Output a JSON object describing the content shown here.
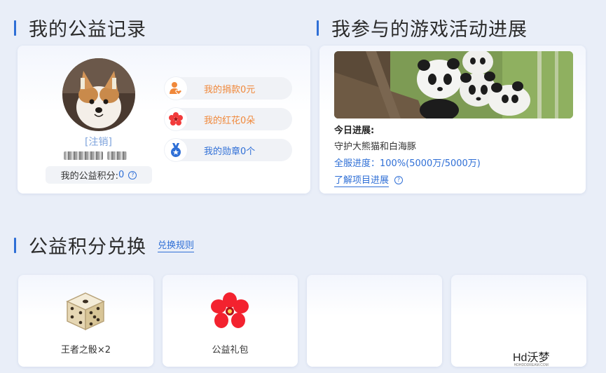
{
  "titles": {
    "records": "我的公益记录",
    "game_progress": "我参与的游戏活动进展",
    "exchange": "公益积分兑换"
  },
  "exchange_rules_link": "兑换规则",
  "profile": {
    "logout_label": "[注销]",
    "points_label": "我的公益积分:",
    "points_value": "0",
    "help_symbol": "?"
  },
  "stats": [
    {
      "label": "我的捐款0元",
      "icon": "donation-user-heart-icon",
      "color": "#f0883a"
    },
    {
      "label": "我的红花0朵",
      "icon": "red-flower-icon",
      "color": "#f23b3b"
    },
    {
      "label": "我的勋章0个",
      "icon": "medal-icon",
      "color": "#2f6fd6"
    }
  ],
  "game": {
    "today_label": "今日进展:",
    "project_name": "守护大熊猫和白海豚",
    "progress_text": "全服进度：100%(5000万/5000万)",
    "progress_fraction": 1.0,
    "learn_more_label": "了解项目进展",
    "help_symbol": "?"
  },
  "rewards": [
    {
      "label": "王者之骰×2",
      "icon": "dice-icon"
    },
    {
      "label": "公益礼包",
      "icon": "red-flower-gift-icon"
    },
    {
      "label": "",
      "icon": ""
    },
    {
      "label": "",
      "icon": ""
    }
  ],
  "watermark": {
    "text": "Hd沃梦",
    "sub": "HDHDDDREAM.COM"
  },
  "colors": {
    "accent": "#2f6fd6",
    "background": "#e9eef8",
    "donation": "#f0883a",
    "flower": "#f23b3b"
  }
}
